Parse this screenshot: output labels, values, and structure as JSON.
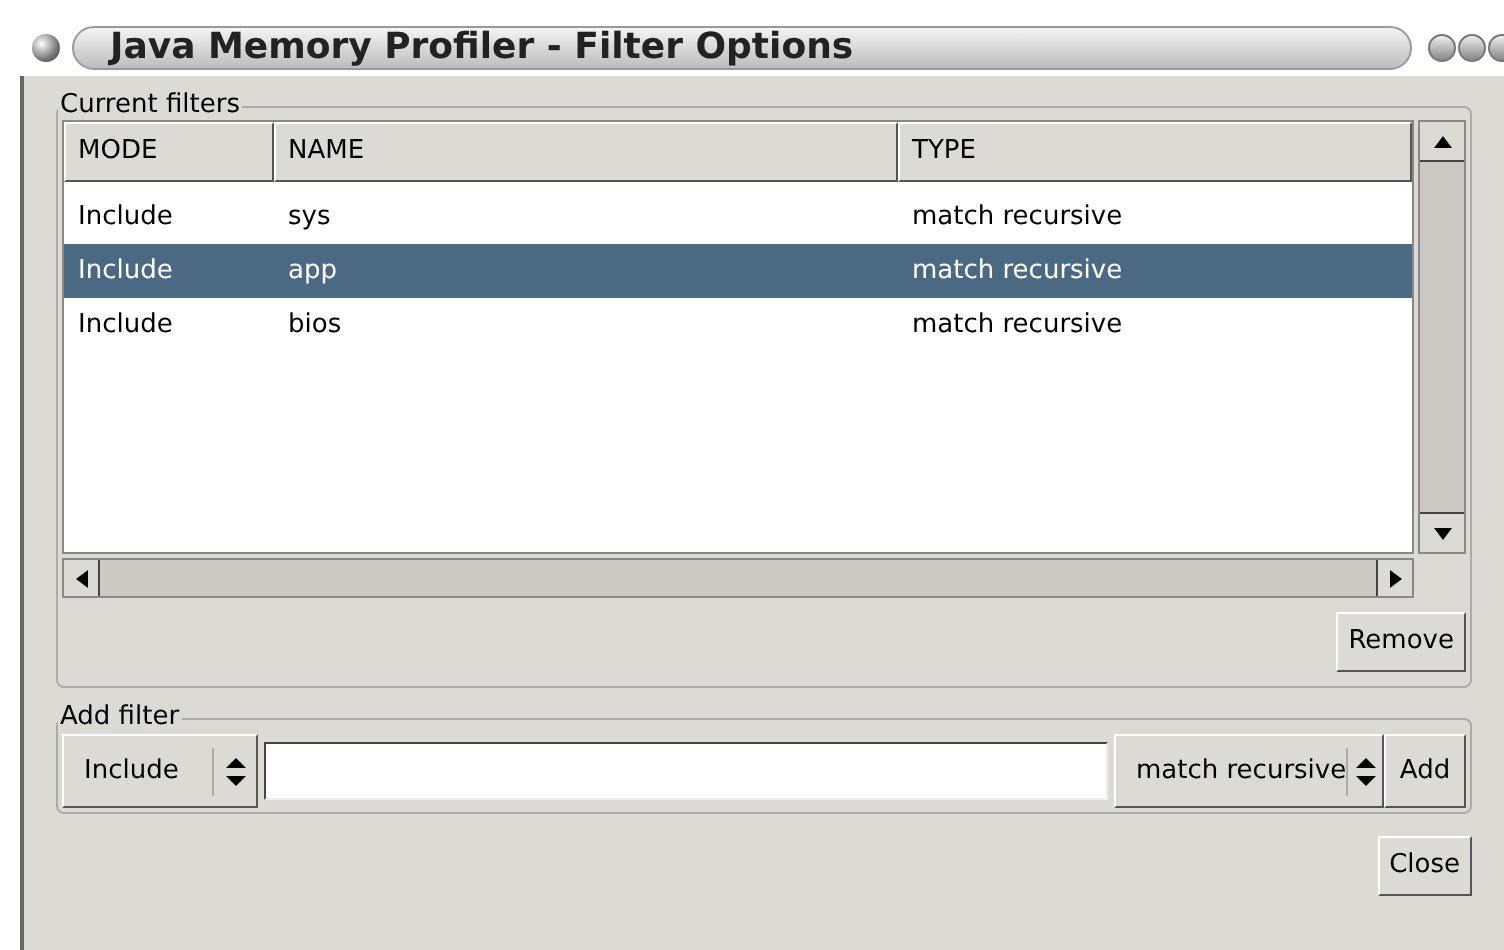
{
  "window": {
    "title": "Java Memory Profiler - Filter Options"
  },
  "current_filters": {
    "legend": "Current filters",
    "table": {
      "columns": [
        "MODE",
        "NAME",
        "TYPE"
      ],
      "rows": [
        {
          "mode": "Include",
          "name": "sys",
          "type": "match recursive",
          "selected": false
        },
        {
          "mode": "Include",
          "name": "app",
          "type": "match recursive",
          "selected": true
        },
        {
          "mode": "Include",
          "name": "bios",
          "type": "match recursive",
          "selected": false
        }
      ]
    },
    "remove_button": "Remove"
  },
  "add_filter": {
    "legend": "Add filter",
    "mode": "Include",
    "type": "match recursive",
    "add_button": "Add"
  },
  "close_button": "Close"
}
